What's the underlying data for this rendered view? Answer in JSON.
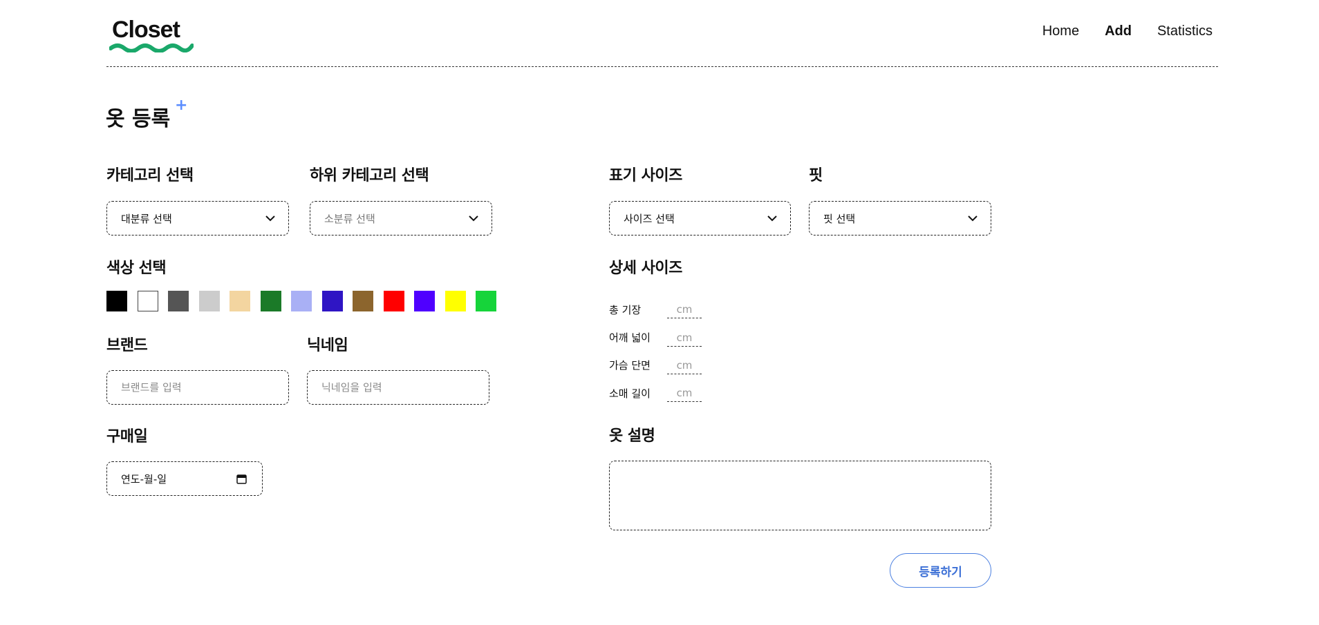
{
  "header": {
    "logo_text": "Closet",
    "nav": {
      "home": "Home",
      "add": "Add",
      "statistics": "Statistics"
    }
  },
  "page": {
    "title": "옷 등록",
    "plus": "+"
  },
  "category": {
    "label": "카테고리 선택",
    "value": "대분류 선택"
  },
  "subcategory": {
    "label": "하위 카테고리 선택",
    "value": "소분류 선택"
  },
  "size": {
    "label": "표기 사이즈",
    "value": "사이즈 선택"
  },
  "fit": {
    "label": "핏",
    "value": "핏 선택"
  },
  "color": {
    "label": "색상 선택",
    "swatches": [
      "#000000",
      "#ffffff",
      "#555555",
      "#cccccc",
      "#f3d5a0",
      "#1b7a28",
      "#a9b0f5",
      "#2f15c4",
      "#8c652d",
      "#ff0000",
      "#4f00ff",
      "#ffff00",
      "#16d43a"
    ]
  },
  "brand": {
    "label": "브랜드",
    "placeholder": "브랜드를 입력"
  },
  "nickname": {
    "label": "닉네임",
    "placeholder": "닉네임을 입력"
  },
  "purchase_date": {
    "label": "구매일",
    "value": "연도-월-일"
  },
  "detail_size": {
    "label": "상세 사이즈",
    "unit_placeholder": "cm",
    "rows": [
      "총 기장",
      "어깨 넓이",
      "가슴 단면",
      "소매 길이"
    ]
  },
  "description": {
    "label": "옷 설명"
  },
  "submit": {
    "label": "등록하기"
  },
  "colors": {
    "accent": "#3b6fd6",
    "logo_green": "#1aa86a"
  }
}
